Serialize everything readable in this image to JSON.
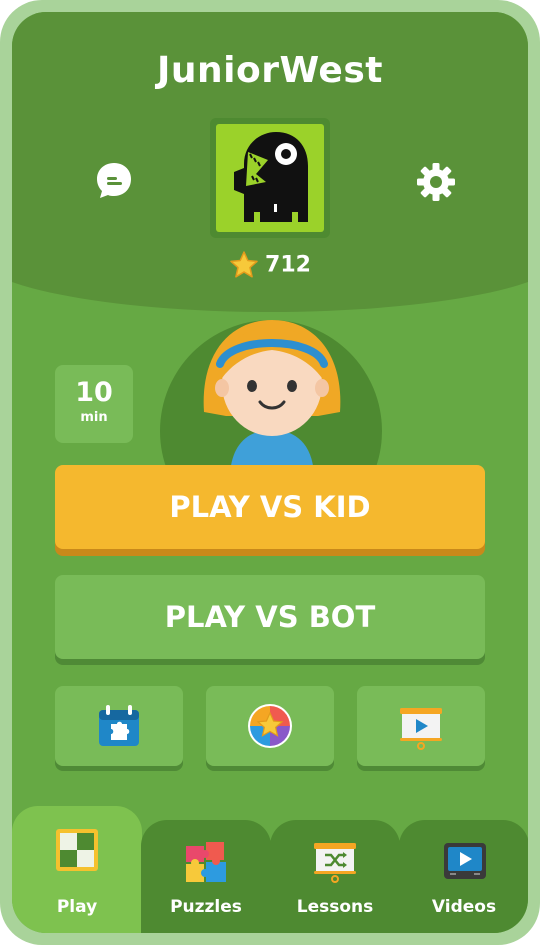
{
  "app": {
    "brand": "JuniorWest"
  },
  "header": {
    "chat_icon": "chat-bubble-icon",
    "settings_icon": "gear-icon",
    "avatar": "monster-avatar",
    "rating": "712",
    "rating_icon": "star-icon"
  },
  "game": {
    "time_value": "10",
    "time_unit": "min",
    "play_kid_label": "PLAY VS KID",
    "play_bot_label": "PLAY VS BOT"
  },
  "quick_actions": [
    {
      "icon": "puzzle-calendar-icon"
    },
    {
      "icon": "star-badge-icon"
    },
    {
      "icon": "video-board-icon"
    }
  ],
  "nav": {
    "tabs": [
      {
        "label": "Play",
        "icon": "chessboard-icon",
        "active": true
      },
      {
        "label": "Puzzles",
        "icon": "puzzle-pieces-icon",
        "active": false
      },
      {
        "label": "Lessons",
        "icon": "lesson-board-icon",
        "active": false
      },
      {
        "label": "Videos",
        "icon": "tv-play-icon",
        "active": false
      }
    ]
  },
  "colors": {
    "background": "#66a944",
    "header": "#5a9239",
    "primary_button": "#f5b82e",
    "secondary_button": "#79bb58",
    "frame": "#a9d39a"
  }
}
